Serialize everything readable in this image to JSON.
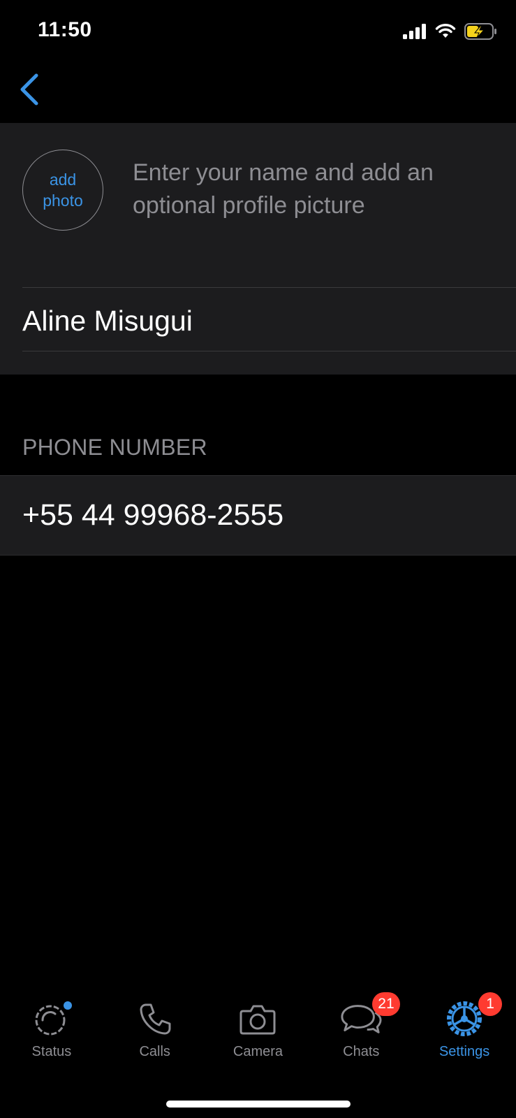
{
  "status_bar": {
    "time": "11:50"
  },
  "nav": {
    "back_icon": "chevron-left-icon"
  },
  "profile": {
    "add_photo_line1": "add",
    "add_photo_line2": "photo",
    "hint": "Enter your name and add an optional profile picture",
    "name_value": "Aline Misugui"
  },
  "phone": {
    "header": "PHONE NUMBER",
    "value": "+55 44 99968-2555"
  },
  "tabs": [
    {
      "label": "Status",
      "icon": "status-icon"
    },
    {
      "label": "Calls",
      "icon": "phone-icon"
    },
    {
      "label": "Camera",
      "icon": "camera-icon"
    },
    {
      "label": "Chats",
      "icon": "chat-bubbles-icon",
      "badge": "21"
    },
    {
      "label": "Settings",
      "icon": "gear-icon",
      "badge": "1",
      "active": true
    }
  ],
  "colors": {
    "accent": "#3b94e6",
    "badge": "#ff3b30",
    "panel": "#1c1c1e",
    "secondary_text": "#8e8e93",
    "battery": "#f5d21c"
  }
}
